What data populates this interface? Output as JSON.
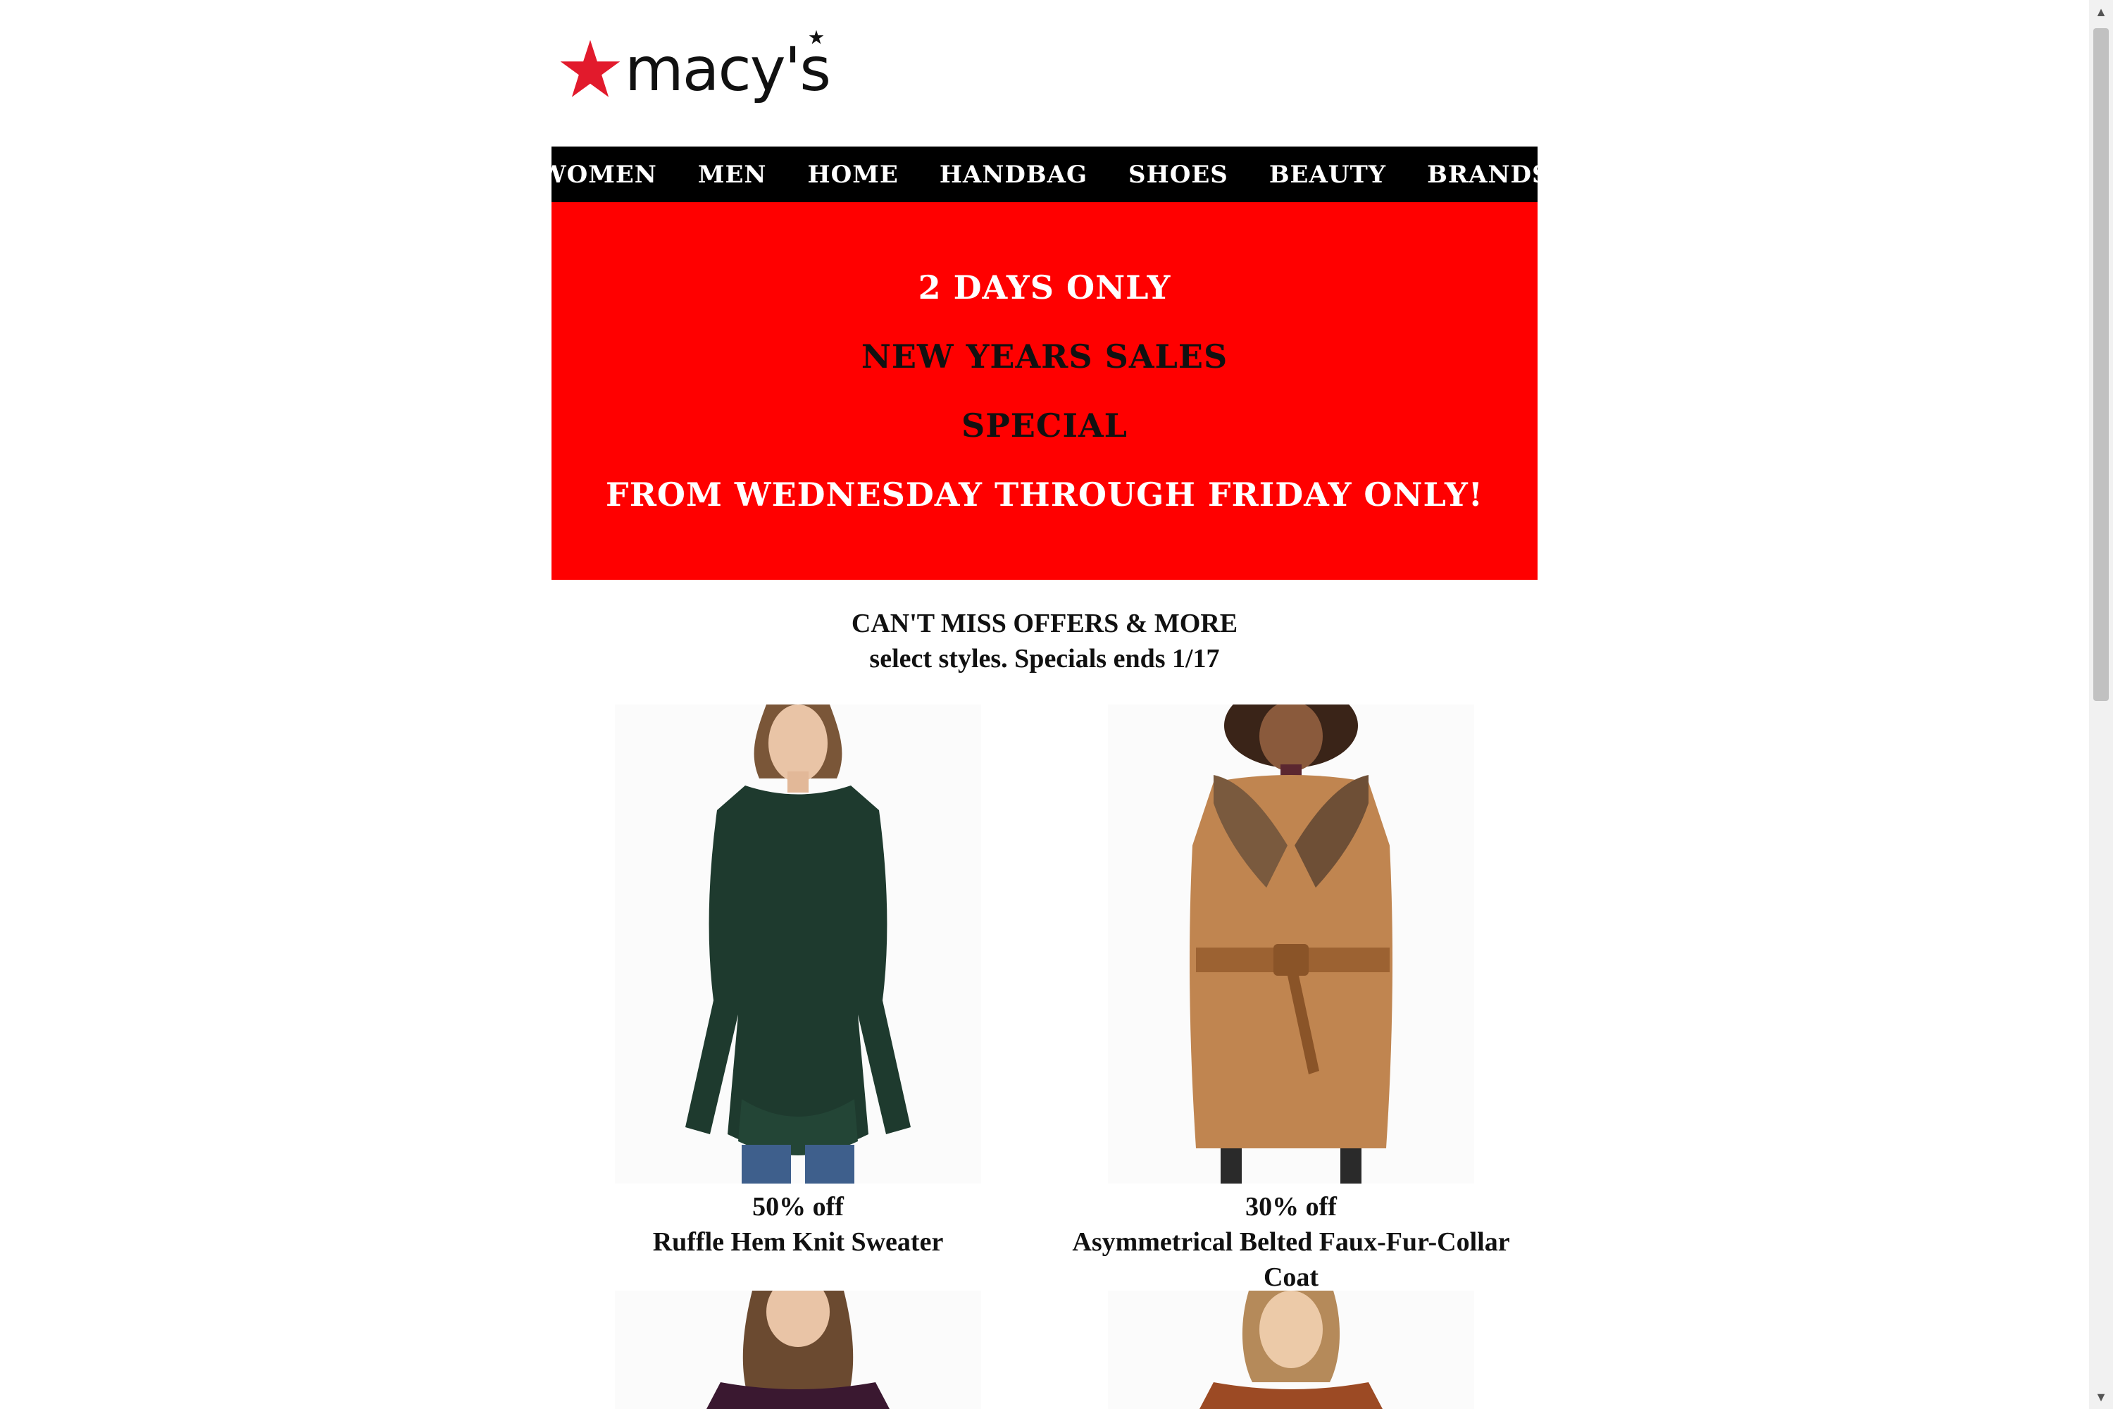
{
  "logo": {
    "text": "macy's",
    "icon": "macys-star-icon",
    "brand_color": "#e21a2c"
  },
  "nav": {
    "items": [
      {
        "label": "WOMEN"
      },
      {
        "label": "MEN"
      },
      {
        "label": "HOME"
      },
      {
        "label": "HANDBAG"
      },
      {
        "label": "SHOES"
      },
      {
        "label": "BEAUTY"
      },
      {
        "label": "BRANDS"
      }
    ]
  },
  "banner": {
    "background": "#ff0000",
    "lines": [
      "2 DAYS ONLY",
      "NEW YEARS SALES",
      "SPECIAL",
      "FROM WEDNESDAY THROUGH FRIDAY ONLY!"
    ]
  },
  "offers": {
    "title": "CAN'T MISS OFFERS & MORE",
    "subtitle": "select styles. Specials ends 1/17"
  },
  "products": [
    {
      "discount": "50% off",
      "name": "Ruffle Hem Knit Sweater"
    },
    {
      "discount": "30% off",
      "name": "Asymmetrical Belted Faux-Fur-Collar Coat"
    }
  ]
}
